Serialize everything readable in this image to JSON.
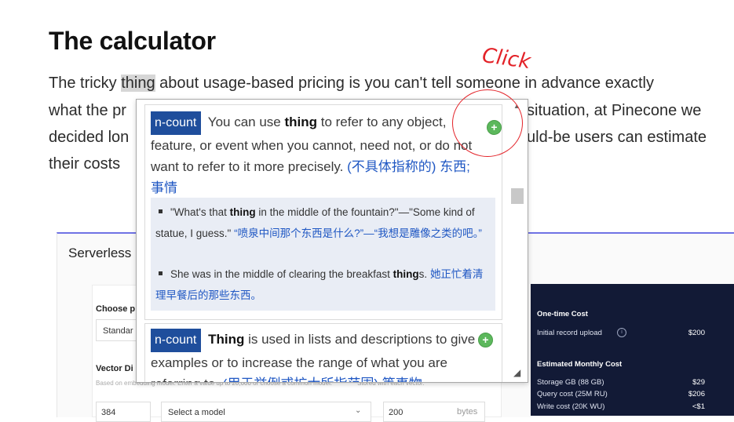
{
  "article": {
    "heading": "The calculator",
    "line1_before": "The tricky ",
    "line1_highlight": "thing",
    "line1_after": " about usage-based pricing is you can't tell someone in advance exactly",
    "line2_left": "what the pr",
    "line2_right": "situation, at Pinecone we",
    "line3_left": "decided lon",
    "line3_right": "uld-be users can estimate",
    "line4_left": "their costs"
  },
  "calculator": {
    "tab_label": "Serverless",
    "tab_paren": ")",
    "choose_label": "Choose p",
    "standard_value": "Standar",
    "vector_label": "Vector Di",
    "vector_help": "Based on embedding model. Enter a value up to 20,000 or choose a common model.",
    "metadata_help": "Stored with each vector.",
    "vector_value": "384",
    "model_placeholder": "Select a model",
    "model_chevron": "⌄",
    "metadata_value": "200",
    "metadata_unit": "bytes"
  },
  "costs": {
    "one_time_heading": "One-time Cost",
    "initial_upload_label": "Initial record upload",
    "initial_upload_value": "$200",
    "info_icon_glyph": "i",
    "monthly_heading": "Estimated Monthly Cost",
    "storage_label": "Storage GB (88 GB)",
    "storage_value": "$29",
    "query_label": "Query cost (25M RU)",
    "query_value": "$206",
    "write_label": "Write cost (20K WU)",
    "write_value": "<$1"
  },
  "dictionary": {
    "entry1": {
      "pos": "n-count",
      "def_pre": " You can use ",
      "def_word": "thing",
      "def_post": " to refer to any object, feature, or event when you cannot, need not, or do not want to refer to it more precisely. ",
      "def_cn": "(不具体指称的) 东西; 事情",
      "examples": [
        {
          "pre": "\"What's that ",
          "word": "thing",
          "post": " in the middle of the fountain?\"—\"Some kind of statue, I guess.\" ",
          "cn": "“喷泉中间那个东西是什么?”—“我想是雕像之类的吧。”"
        },
        {
          "pre": "She was in the middle of clearing the breakfast ",
          "word": "thing",
          "post": "s. ",
          "cn": "她正忙着清理早餐后的那些东西。"
        }
      ]
    },
    "entry2": {
      "pos": "n-count",
      "def_pre": " ",
      "def_word": "Thing",
      "def_post": " is used in lists and descriptions to give examples or to increase the range of what you are referring to. ",
      "def_cn": "(用于举例或扩大所指范围) 等事物"
    },
    "add_glyph": "+"
  },
  "popup_controls": {
    "scroll_up_glyph": "▲",
    "resize_glyph": "◢"
  },
  "annotation": {
    "click_text": "Click",
    "color": "#e32228"
  }
}
